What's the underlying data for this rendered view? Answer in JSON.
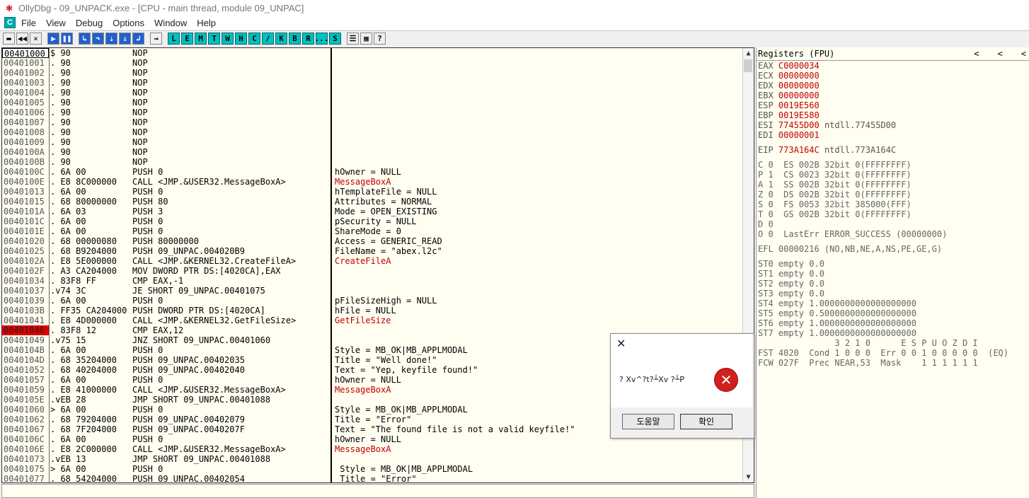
{
  "window": {
    "title": "OllyDbg - 09_UNPACK.exe - [CPU - main thread, module 09_UNPAC]"
  },
  "menu": [
    "File",
    "View",
    "Debug",
    "Options",
    "Window",
    "Help"
  ],
  "toolbar": [
    "L",
    "E",
    "M",
    "T",
    "W",
    "H",
    "C",
    "/",
    "K",
    "B",
    "R",
    "...",
    "S"
  ],
  "disasm": {
    "rows": [
      {
        "addr": "00401000",
        "hex": "$ 90",
        "asm": "NOP",
        "cmt": ""
      },
      {
        "addr": "00401001",
        "hex": ". 90",
        "asm": "NOP",
        "cmt": ""
      },
      {
        "addr": "00401002",
        "hex": ". 90",
        "asm": "NOP",
        "cmt": ""
      },
      {
        "addr": "00401003",
        "hex": ". 90",
        "asm": "NOP",
        "cmt": ""
      },
      {
        "addr": "00401004",
        "hex": ". 90",
        "asm": "NOP",
        "cmt": ""
      },
      {
        "addr": "00401005",
        "hex": ". 90",
        "asm": "NOP",
        "cmt": ""
      },
      {
        "addr": "00401006",
        "hex": ". 90",
        "asm": "NOP",
        "cmt": ""
      },
      {
        "addr": "00401007",
        "hex": ". 90",
        "asm": "NOP",
        "cmt": ""
      },
      {
        "addr": "00401008",
        "hex": ". 90",
        "asm": "NOP",
        "cmt": ""
      },
      {
        "addr": "00401009",
        "hex": ". 90",
        "asm": "NOP",
        "cmt": ""
      },
      {
        "addr": "0040100A",
        "hex": ". 90",
        "asm": "NOP",
        "cmt": ""
      },
      {
        "addr": "0040100B",
        "hex": ". 90",
        "asm": "NOP",
        "cmt": ""
      },
      {
        "addr": "0040100C",
        "hex": ". 6A 00",
        "asm": "PUSH 0",
        "cmt": "hOwner = NULL"
      },
      {
        "addr": "0040100E",
        "hex": ". E8 8C000000",
        "asm": "CALL <JMP.&USER32.MessageBoxA>",
        "cmt": "MessageBoxA",
        "red": true
      },
      {
        "addr": "00401013",
        "hex": ". 6A 00",
        "asm": "PUSH 0",
        "cmt": "hTemplateFile = NULL"
      },
      {
        "addr": "00401015",
        "hex": ". 68 80000000",
        "asm": "PUSH 80",
        "cmt": "Attributes = NORMAL"
      },
      {
        "addr": "0040101A",
        "hex": ". 6A 03",
        "asm": "PUSH 3",
        "cmt": "Mode = OPEN_EXISTING"
      },
      {
        "addr": "0040101C",
        "hex": ". 6A 00",
        "asm": "PUSH 0",
        "cmt": "pSecurity = NULL"
      },
      {
        "addr": "0040101E",
        "hex": ". 6A 00",
        "asm": "PUSH 0",
        "cmt": "ShareMode = 0"
      },
      {
        "addr": "00401020",
        "hex": ". 68 00000080",
        "asm": "PUSH 80000000",
        "cmt": "Access = GENERIC_READ"
      },
      {
        "addr": "00401025",
        "hex": ". 68 B9204000",
        "asm": "PUSH 09_UNPAC.004020B9",
        "cmt": "FileName = \"abex.l2c\""
      },
      {
        "addr": "0040102A",
        "hex": ". E8 5E000000",
        "asm": "CALL <JMP.&KERNEL32.CreateFileA>",
        "cmt": "CreateFileA",
        "red": true
      },
      {
        "addr": "0040102F",
        "hex": ". A3 CA204000",
        "asm": "MOV DWORD PTR DS:[4020CA],EAX",
        "cmt": ""
      },
      {
        "addr": "00401034",
        "hex": ". 83F8 FF",
        "asm": "CMP EAX,-1",
        "cmt": ""
      },
      {
        "addr": "00401037",
        "hex": ".v74 3C",
        "asm": "JE SHORT 09_UNPAC.00401075",
        "cmt": ""
      },
      {
        "addr": "00401039",
        "hex": ". 6A 00",
        "asm": "PUSH 0",
        "cmt": "pFileSizeHigh = NULL"
      },
      {
        "addr": "0040103B",
        "hex": ". FF35 CA204000",
        "asm": "PUSH DWORD PTR DS:[4020CA]",
        "cmt": "hFile = NULL"
      },
      {
        "addr": "00401041",
        "hex": ". E8 4D000000",
        "asm": "CALL <JMP.&KERNEL32.GetFileSize>",
        "cmt": "GetFileSize",
        "red": true
      },
      {
        "addr": "00401046",
        "hex": ". 83F8 12",
        "asm": "CMP EAX,12",
        "cmt": "",
        "sel": true
      },
      {
        "addr": "00401049",
        "hex": ".v75 15",
        "asm": "JNZ SHORT 09_UNPAC.00401060",
        "cmt": ""
      },
      {
        "addr": "0040104B",
        "hex": ". 6A 00",
        "asm": "PUSH 0",
        "cmt": "Style = MB_OK|MB_APPLMODAL"
      },
      {
        "addr": "0040104D",
        "hex": ". 68 35204000",
        "asm": "PUSH 09_UNPAC.00402035",
        "cmt": "Title = \"Well done!\""
      },
      {
        "addr": "00401052",
        "hex": ". 68 40204000",
        "asm": "PUSH 09_UNPAC.00402040",
        "cmt": "Text = \"Yep, keyfile found!\""
      },
      {
        "addr": "00401057",
        "hex": ". 6A 00",
        "asm": "PUSH 0",
        "cmt": "hOwner = NULL"
      },
      {
        "addr": "00401059",
        "hex": ". E8 41000000",
        "asm": "CALL <JMP.&USER32.MessageBoxA>",
        "cmt": "MessageBoxA",
        "red": true
      },
      {
        "addr": "0040105E",
        "hex": ".vEB 28",
        "asm": "JMP SHORT 09_UNPAC.00401088",
        "cmt": ""
      },
      {
        "addr": "00401060",
        "hex": "> 6A 00",
        "asm": "PUSH 0",
        "cmt": "Style = MB_OK|MB_APPLMODAL"
      },
      {
        "addr": "00401062",
        "hex": ". 68 79204000",
        "asm": "PUSH 09_UNPAC.00402079",
        "cmt": "Title = \"Error\""
      },
      {
        "addr": "00401067",
        "hex": ". 68 7F204000",
        "asm": "PUSH 09_UNPAC.0040207F",
        "cmt": "Text = \"The found file is not a valid keyfile!\""
      },
      {
        "addr": "0040106C",
        "hex": ". 6A 00",
        "asm": "PUSH 0",
        "cmt": "hOwner = NULL"
      },
      {
        "addr": "0040106E",
        "hex": ". E8 2C000000",
        "asm": "CALL <JMP.&USER32.MessageBoxA>",
        "cmt": "MessageBoxA",
        "red": true
      },
      {
        "addr": "00401073",
        "hex": ".vEB 13",
        "asm": "JMP SHORT 09_UNPAC.00401088",
        "cmt": ""
      },
      {
        "addr": "00401075",
        "hex": "> 6A 00",
        "asm": "PUSH 0",
        "cmt": " Style = MB_OK|MB_APPLMODAL"
      },
      {
        "addr": "00401077",
        "hex": ". 68 54204000",
        "asm": "PUSH 09_UNPAC.00402054",
        "cmt": " Title = \"Error\""
      }
    ]
  },
  "registers": {
    "header": "Registers (FPU)",
    "arrows": [
      "<",
      "<",
      "<"
    ],
    "gpr": [
      {
        "name": "EAX",
        "val": "C0000034",
        "extra": ""
      },
      {
        "name": "ECX",
        "val": "00000000",
        "extra": ""
      },
      {
        "name": "EDX",
        "val": "00000000",
        "extra": ""
      },
      {
        "name": "EBX",
        "val": "00000000",
        "extra": ""
      },
      {
        "name": "ESP",
        "val": "0019E560",
        "extra": ""
      },
      {
        "name": "EBP",
        "val": "0019E580",
        "extra": ""
      },
      {
        "name": "ESI",
        "val": "77455D00",
        "extra": " ntdll.77455D00"
      },
      {
        "name": "EDI",
        "val": "00000001",
        "extra": ""
      }
    ],
    "eip": {
      "name": "EIP",
      "val": "773A164C",
      "extra": " ntdll.773A164C"
    },
    "flags": [
      "C 0  ES 002B 32bit 0(FFFFFFFF)",
      "P 1  CS 0023 32bit 0(FFFFFFFF)",
      "A 1  SS 002B 32bit 0(FFFFFFFF)",
      "Z 0  DS 002B 32bit 0(FFFFFFFF)",
      "S 0  FS 0053 32bit 385000(FFF)",
      "T 0  GS 002B 32bit 0(FFFFFFFF)",
      "D 0",
      "O 0  LastErr ERROR_SUCCESS (00000000)"
    ],
    "efl": "EFL 00000216 (NO,NB,NE,A,NS,PE,GE,G)",
    "fpu": [
      "ST0 empty 0.0",
      "ST1 empty 0.0",
      "ST2 empty 0.0",
      "ST3 empty 0.0",
      "ST4 empty 1.0000000000000000000",
      "ST5 empty 0.5000000000000000000",
      "ST6 empty 1.0000000000000000000",
      "ST7 empty 1.0000000000000000000"
    ],
    "fst_hdr": "               3 2 1 0      E S P U O Z D I",
    "fst": "FST 4020  Cond 1 0 0 0  Err 0 0 1 0 0 0 0 0  (EQ)",
    "fcw": "FCW 027F  Prec NEAR,53  Mask    1 1 1 1 1 1"
  },
  "dialog": {
    "close": "✕",
    "message": "? Xv^?t?┴Xv   ?┴P",
    "help_button": "도움말",
    "ok_button": "확인"
  }
}
